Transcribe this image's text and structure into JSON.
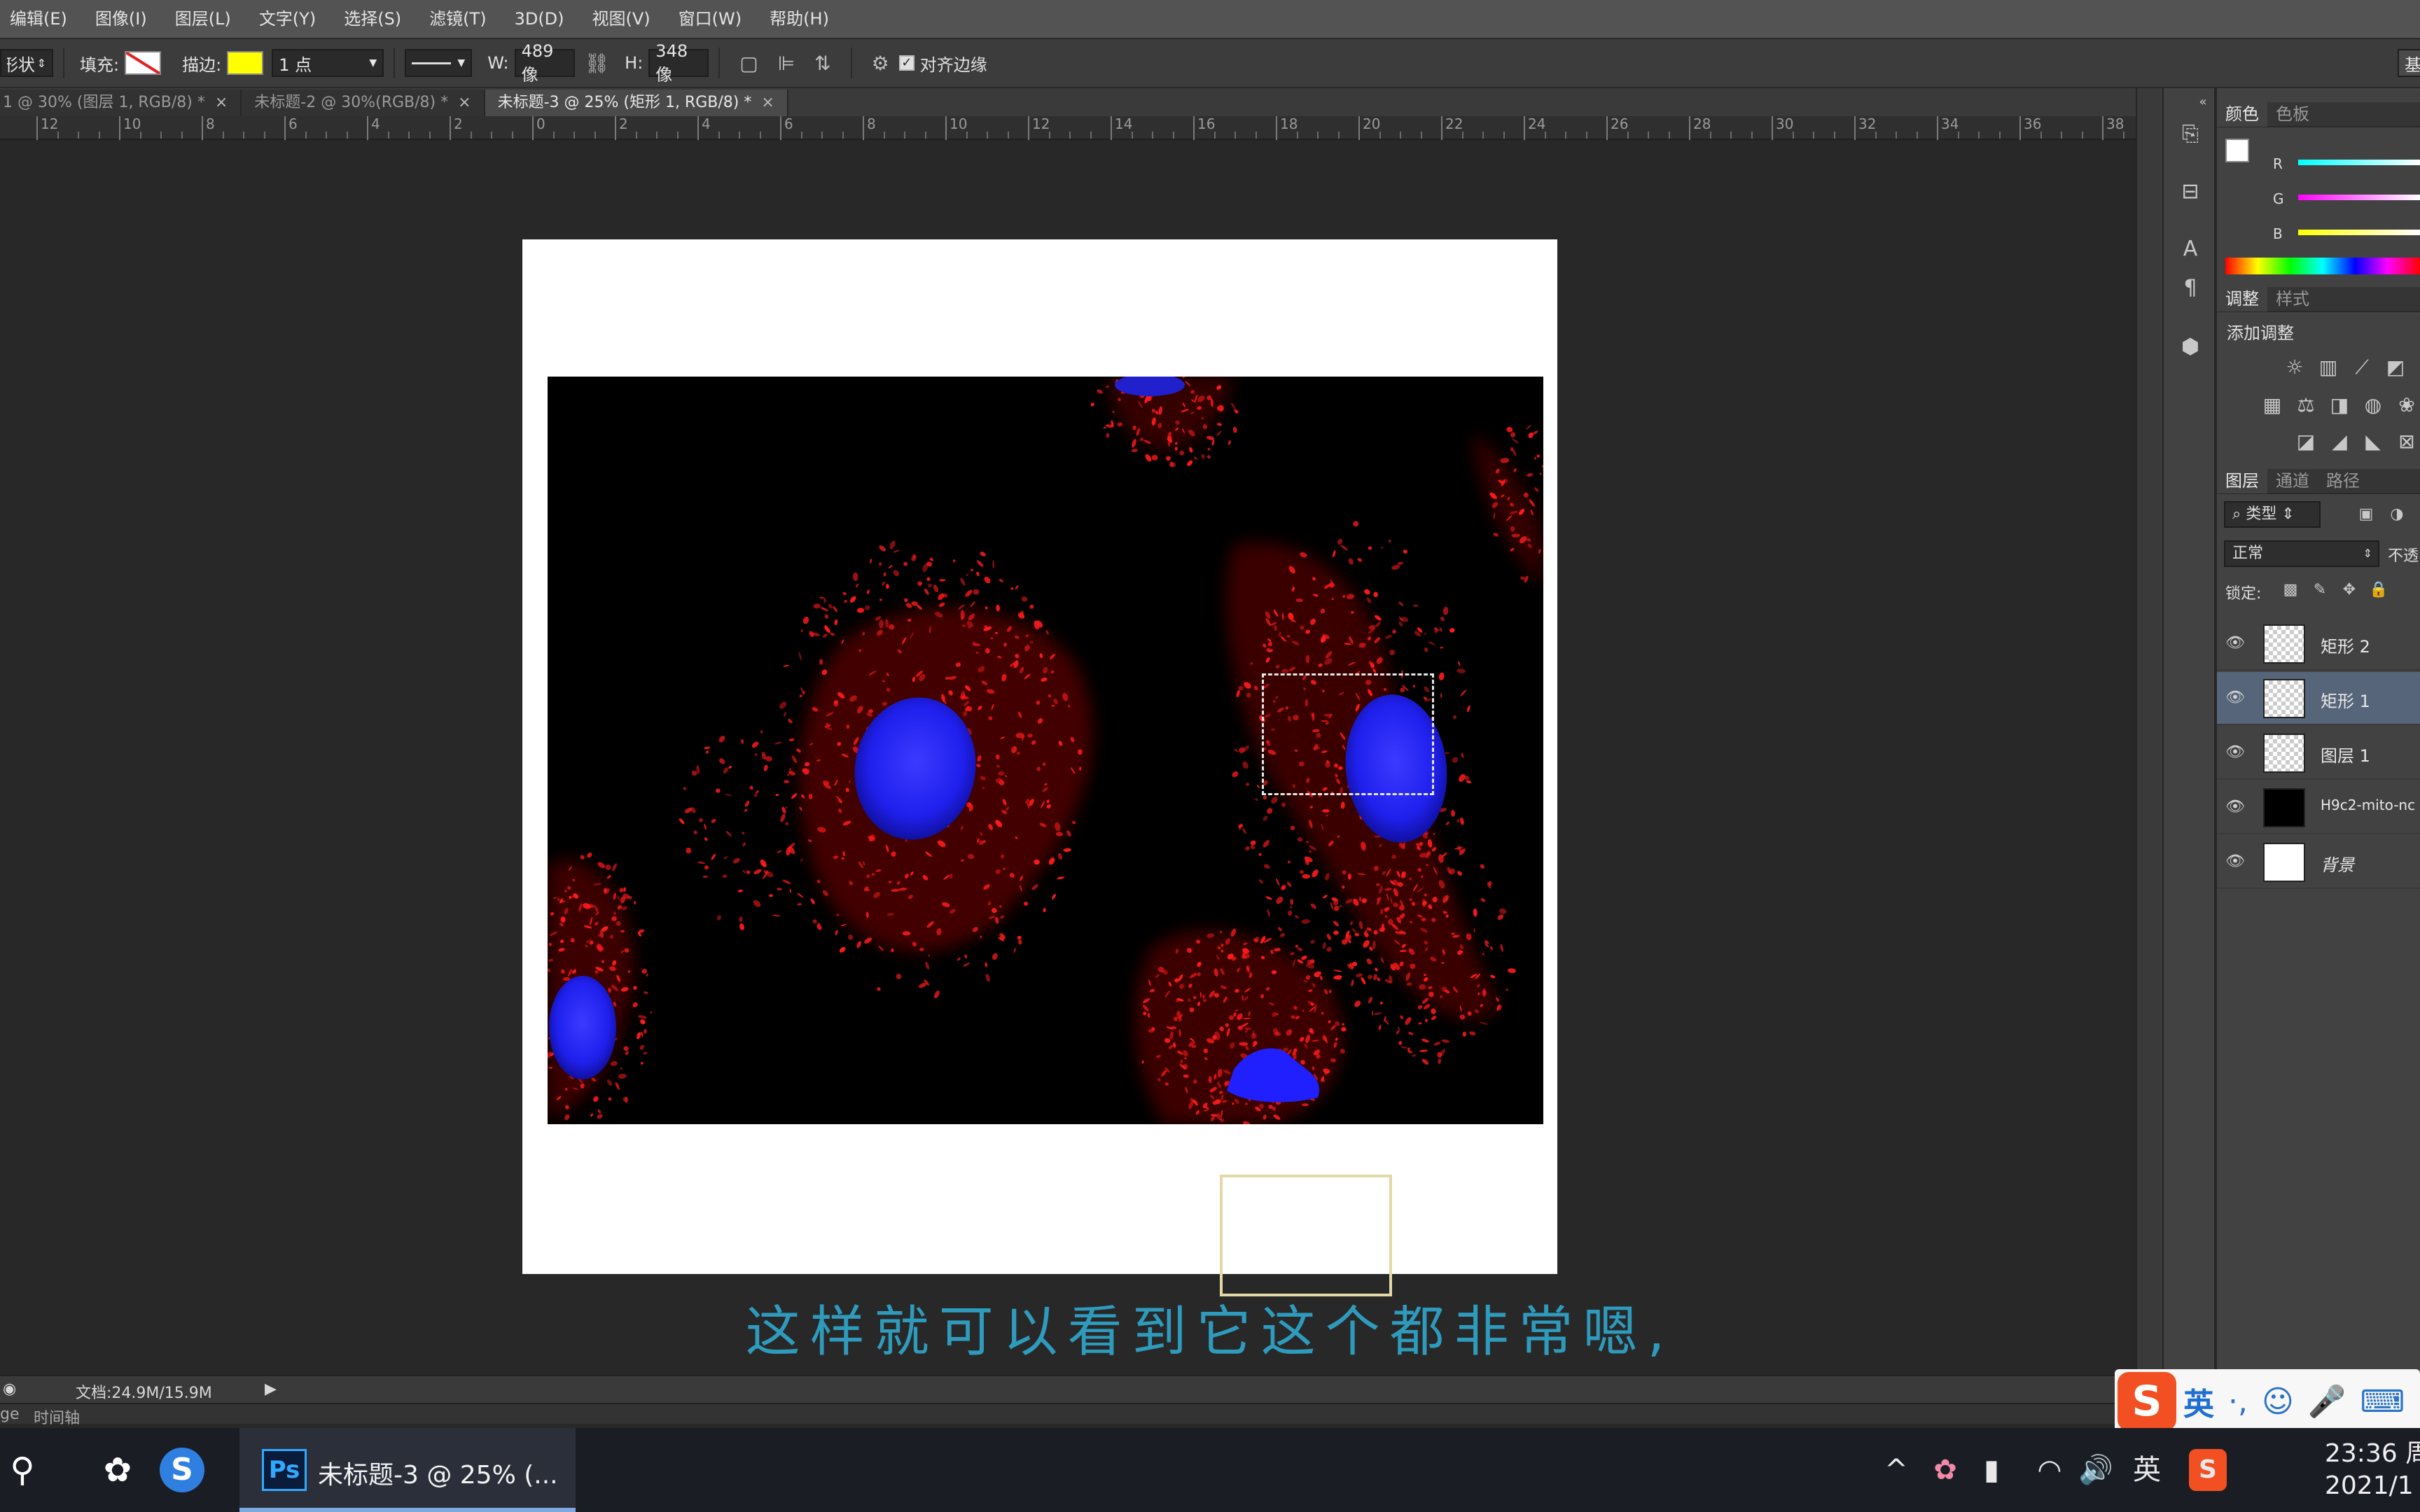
{
  "menubar": {
    "items": [
      "编辑(E)",
      "图像(I)",
      "图层(L)",
      "文字(Y)",
      "选择(S)",
      "滤镜(T)",
      "3D(D)",
      "视图(V)",
      "窗口(W)",
      "帮助(H)"
    ]
  },
  "options": {
    "shape_mode": "形状",
    "fill_label": "填充:",
    "stroke_label": "描边:",
    "stroke_width": "1 点",
    "w_label": "W:",
    "w_value": "489 像",
    "h_label": "H:",
    "h_value": "348 像",
    "align_edges_label": "对齐边缘",
    "stroke_color": "#ffff00",
    "right_button": "基"
  },
  "tabs": [
    {
      "label": "1 @ 30% (图层 1, RGB/8) *",
      "close": "×"
    },
    {
      "label": "未标题-2 @ 30%(RGB/8) *",
      "close": "×"
    },
    {
      "label": "未标题-3 @ 25% (矩形 1, RGB/8) *",
      "close": "×"
    }
  ],
  "ruler": {
    "labels": [
      "12",
      "10",
      "8",
      "6",
      "4",
      "2",
      "0",
      "2",
      "4",
      "6",
      "8",
      "10",
      "12",
      "14",
      "16",
      "18",
      "20",
      "22",
      "24",
      "26",
      "28",
      "30",
      "32",
      "34",
      "36",
      "38"
    ]
  },
  "subtitle": "这样就可以看到它这个都非常嗯,",
  "panels": {
    "color_tabs": [
      "颜色",
      "色板"
    ],
    "channels": [
      "R",
      "G",
      "B"
    ],
    "adjust_tabs": [
      "调整",
      "样式"
    ],
    "add_adjustment": "添加调整",
    "layer_tabs": [
      "图层",
      "通道",
      "路径"
    ],
    "filter_kind": "类型",
    "blend_mode": "正常",
    "opacity_label": "不透",
    "lock_label": "锁定:",
    "layers": [
      {
        "name": "矩形 2",
        "active": false
      },
      {
        "name": "矩形 1",
        "active": true
      },
      {
        "name": "图层 1",
        "active": false
      },
      {
        "name": "H9c2-mito-nc",
        "active": false
      },
      {
        "name": "背景",
        "active": false
      }
    ]
  },
  "status": {
    "doc_info": "文档:24.9M/15.9M",
    "left_tab": "ge",
    "timeline_tab": "时间轴"
  },
  "ime": {
    "lang": "英"
  },
  "taskbar": {
    "ps_label": "Ps",
    "ps_title": "未标题-3 @ 25% (...",
    "tray_lang": "英",
    "time": "23:36 周",
    "date": "2021/1"
  },
  "colors": {
    "accent_blue": "#31a8ff",
    "subtitle": "#2e9bbd",
    "nucleus": "#2a2aff",
    "mito": "#e01010"
  }
}
